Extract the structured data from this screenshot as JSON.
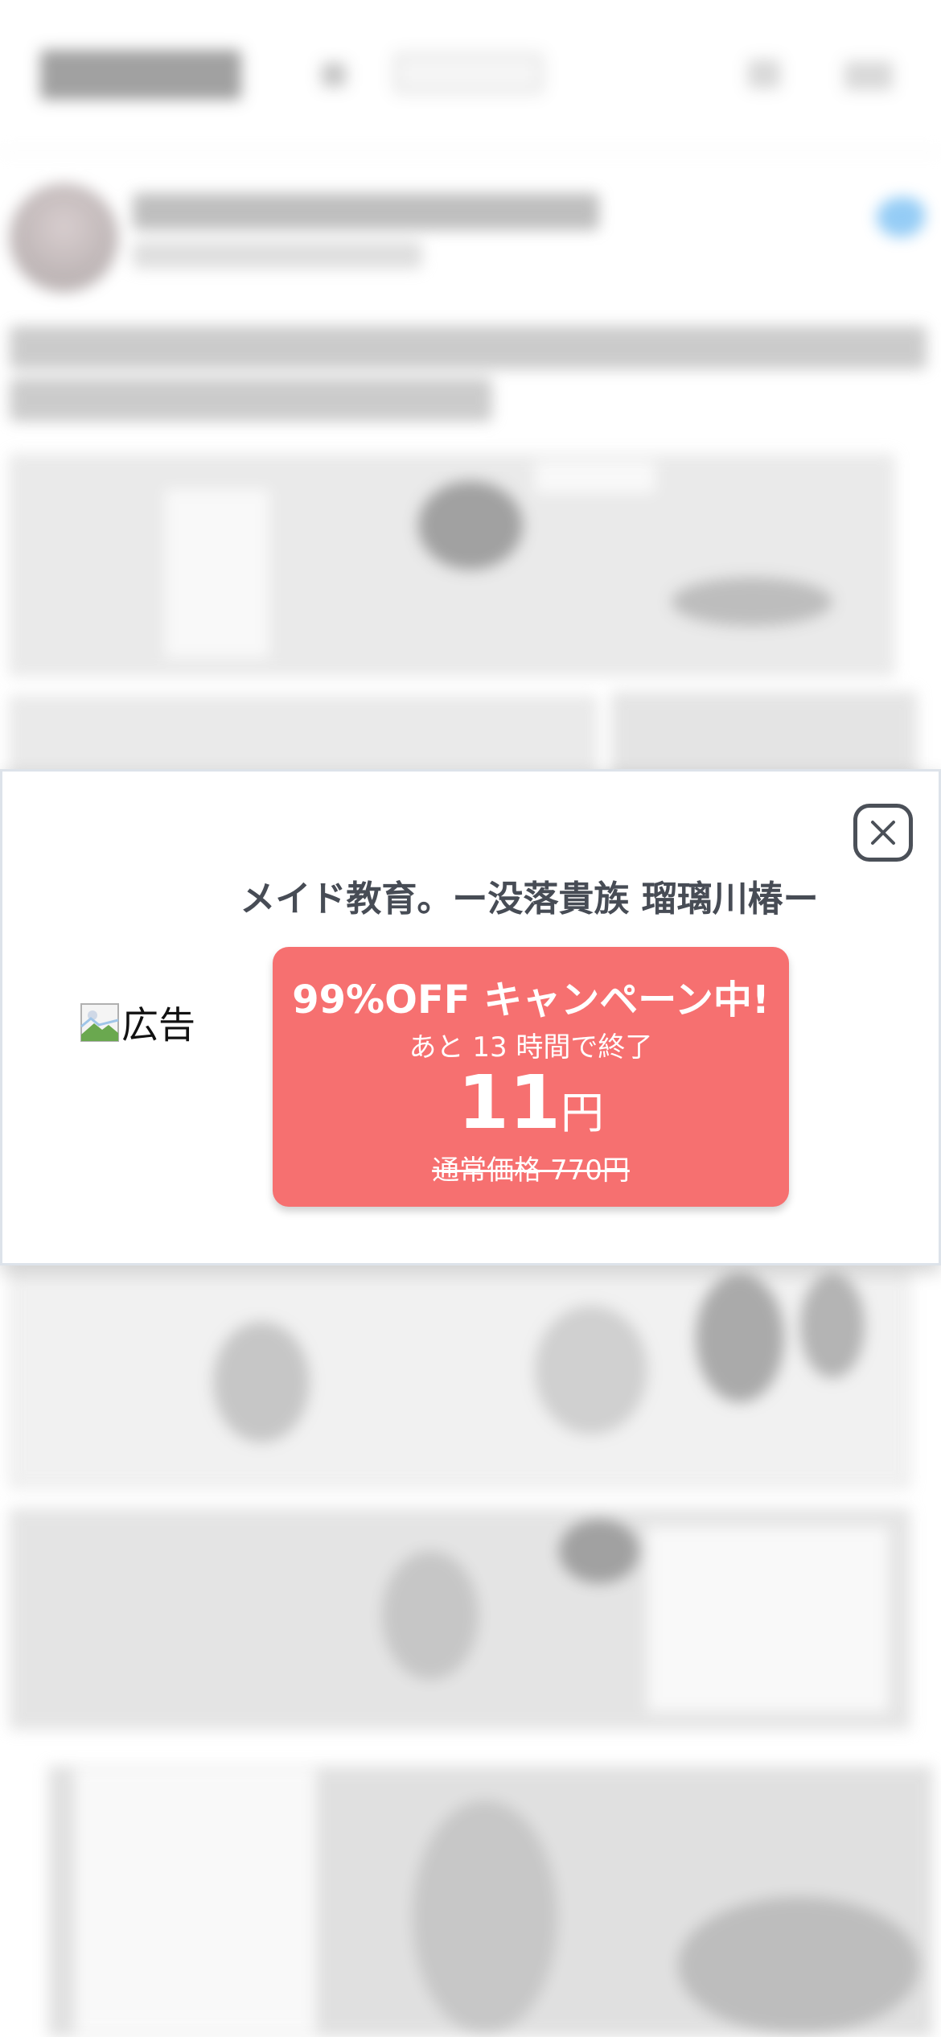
{
  "ad": {
    "title": "メイド教育。ー没落貴族 瑠璃川椿ー",
    "image_alt": "広告",
    "promo": {
      "headline": "99%OFF キャンペーン中!",
      "countdown": "あと 13 時間で終了",
      "price_value": "11",
      "price_unit": "円",
      "regular_price": "通常価格 770円"
    },
    "close_icon": "close-icon",
    "image_icon": "broken-image-icon"
  },
  "colors": {
    "promo_background": "#f67070",
    "title_text": "#474c55",
    "close_border": "#4b5058",
    "twitter_blue": "#3ea3ee"
  }
}
